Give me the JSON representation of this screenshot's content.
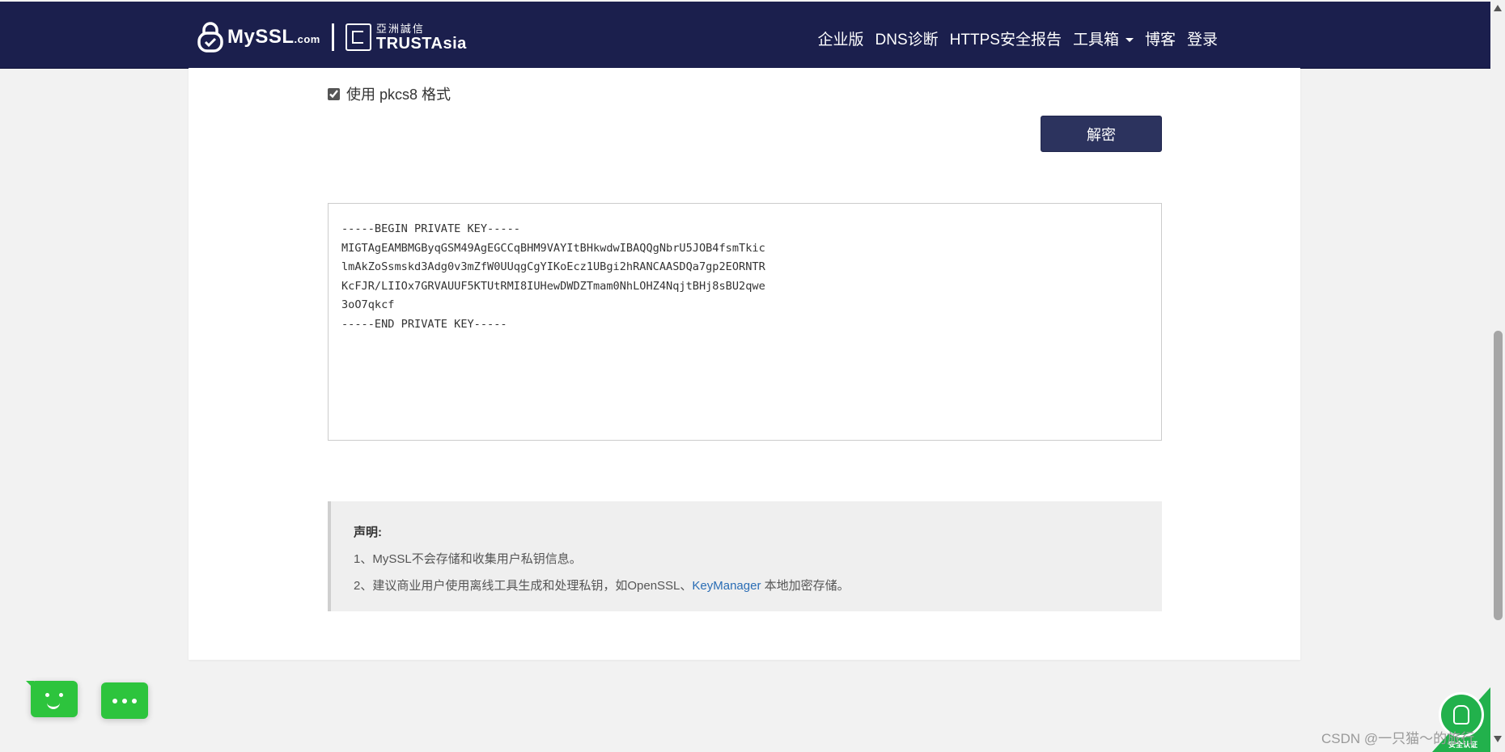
{
  "colors": {
    "navbar_bg": "#1b1f4d",
    "button_bg": "#2c335e",
    "link": "#2a6db5",
    "chat_green": "#2dc43d",
    "seal_green": "#22b14c"
  },
  "header": {
    "brand_myssl": "MySSL",
    "brand_myssl_suffix": ".com",
    "brand_trustasia_cn": "亞洲誠信",
    "brand_trustasia_en": "TRUSTAsia",
    "nav": [
      "企业版",
      "DNS诊断",
      "HTTPS安全报告",
      "工具箱",
      "博客",
      "登录"
    ]
  },
  "form": {
    "pkcs8_label": "使用 pkcs8 格式",
    "pkcs8_checked": true,
    "decrypt_button": "解密",
    "output_key": "-----BEGIN PRIVATE KEY-----\nMIGTAgEAMBMGByqGSM49AgEGCCqBHM9VAYItBHkwdwIBAQQgNbrU5JOB4fsmTkic\nlmAkZoSsmskd3Adg0v3mZfW0UUqgCgYIKoEcz1UBgi2hRANCAASDQa7gp2EORNTR\nKcFJR/LIIOx7GRVAUUF5KTUtRMI8IUHewDWDZTmam0NhLOHZ4NqjtBHj8sBU2qwe\n3oO7qkcf\n-----END PRIVATE KEY-----"
  },
  "notice": {
    "title": "声明:",
    "line1": "1、MySSL不会存储和收集用户私钥信息。",
    "line2_prefix": "2、建议商业用户使用离线工具生成和处理私钥，如OpenSSL、",
    "line2_link": "KeyManager",
    "line2_suffix": " 本地加密存储。"
  },
  "icons": {
    "brand_logo": "lock-shield-icon",
    "chat_widget": "smiley-chat-icon",
    "more_chat": "ellipsis-chat-icon",
    "security_seal": "lock-seal-icon"
  },
  "seal_text": "安全认证",
  "watermark": "CSDN @一只猫～的旅行"
}
